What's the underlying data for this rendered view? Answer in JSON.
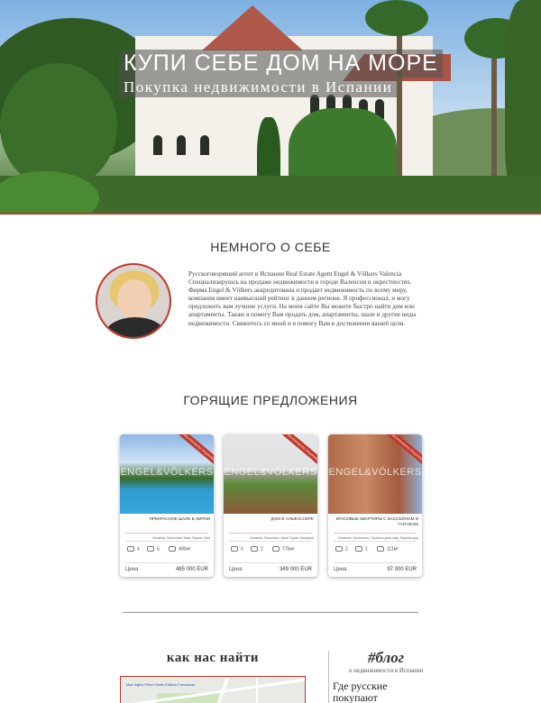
{
  "hero": {
    "title": "КУПИ СЕБЕ ДОМ НА МОРЕ",
    "subtitle": "Покупка недвижимости в Испании"
  },
  "about": {
    "title": "НЕМНОГО О СЕБЕ",
    "text": "Русскоговорящий агент в Испании Real Estate Agent Engel & Völkers Valencia Специализируюсь на продаже недвижимости в городе Валенсия и окрестностях. Фирма Engel & Völkers аккредитована и продает недвижимость по всему миру, компания имеет наивысший рейтинг в данном регионе. Я профессионал, и могу предложить вам лучшие услуги. На моем сайте Вы можете быстро найти дом или апартаменты. Также я помогу Вам продать дом, апартаменты, шале и другие виды недвижимости. Свяжитесь со мной и я помогу Вам в достижении вашей цели."
  },
  "offers": {
    "title": "ГОРЯЩИЕ ПРЕДЛОЖЕНИЯ",
    "watermark": "ENGEL&VÖLKERS",
    "price_label": "Цена",
    "cards": [
      {
        "ribbon": "ЭКСКЛЮЗИВНОЕ ПРЕДЛОЖЕНИЕ",
        "title": "ПРЕКРАСНОЕ ШАЛЕ В ЛИРИИ",
        "location": "Испания, Валенсия, Кемп Лирия, Lliria",
        "beds": "4",
        "baths": "5",
        "area": "400м²",
        "price": "485 000 EUR"
      },
      {
        "ribbon": "ЭКСКЛЮЗИВНОЕ ПРЕДЛОЖЕНИЕ",
        "title": "ДОМ В АЛЬФАССЕРЕ",
        "location": "Испания, Валенсия, Кемп Турия, Альфара",
        "beds": "5",
        "baths": "2",
        "area": "775м²",
        "price": "349 000 EUR"
      },
      {
        "ribbon": "ЭКСКЛЮЗИВНОЕ ПРЕДЛОЖЕНИЕ",
        "title": "КРАСИВЫЕ КВАРТИРЫ С БАССЕЙНОМ И ГАРАЖОМ",
        "location": "Испания, Кастельон, Оропеса дель мар, Марина дор",
        "beds": "2",
        "baths": "1",
        "area": "111м²",
        "price": "97 000 EUR"
      }
    ]
  },
  "find": {
    "title": "как нас найти",
    "map_text": "Mas Inglés Pinter Distin Edificio Fuensanta"
  },
  "blog": {
    "tag": "#блог",
    "subtitle": "о недвижимости в Испании",
    "post_title": "Где русские покупают недвижимость в"
  },
  "colors": {
    "accent": "#c0392b"
  }
}
